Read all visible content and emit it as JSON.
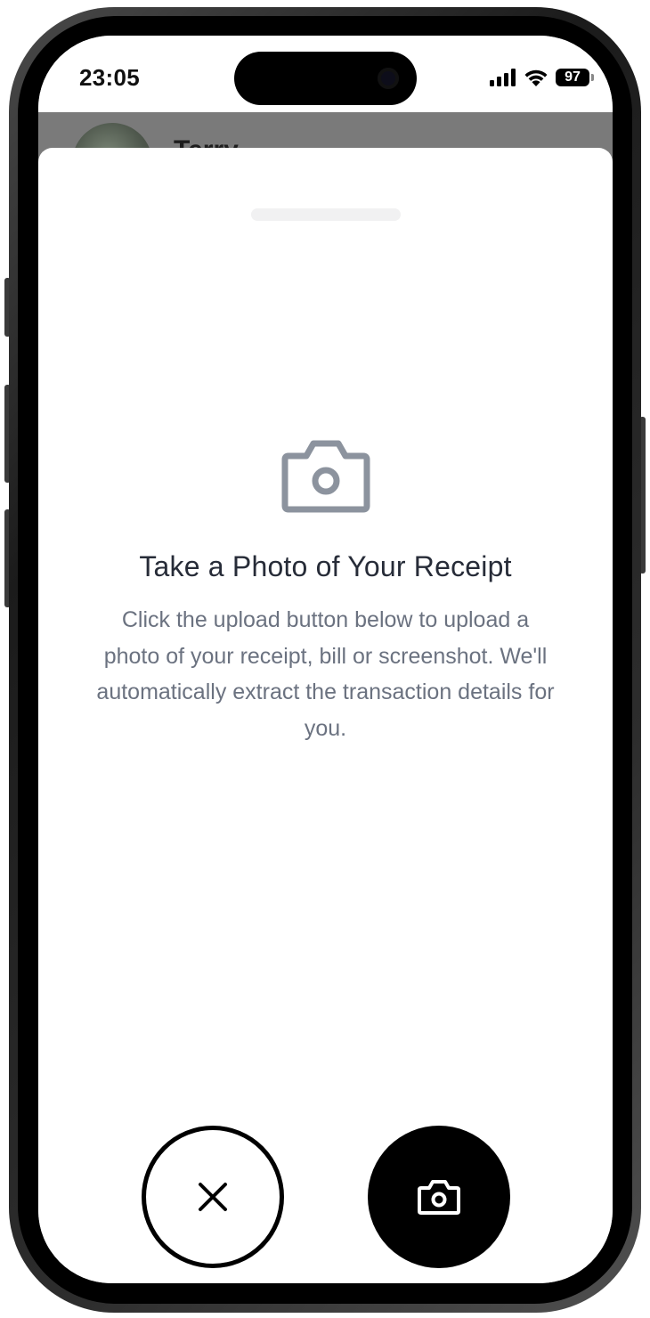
{
  "status_bar": {
    "time": "23:05",
    "battery": "97"
  },
  "background_page": {
    "name": "Terry"
  },
  "upload_sheet": {
    "title": "Take a Photo of Your Receipt",
    "description": "Click the upload button below to upload a photo of your receipt, bill or screenshot. We'll automatically extract the transaction details for you.",
    "hero_icon": "camera-icon"
  },
  "actions": {
    "close_icon": "close-icon",
    "capture_icon": "camera-icon"
  },
  "colors": {
    "title": "#272c38",
    "description": "#6b7280",
    "hero_icon": "#8c939e",
    "primary_button": "#000000"
  }
}
